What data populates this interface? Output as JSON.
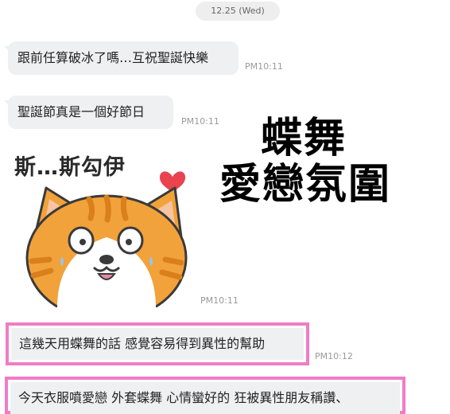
{
  "date_separator": "12.25 (Wed)",
  "messages": [
    {
      "text": "跟前任算破冰了嗎…互祝聖誕快樂",
      "time": "PM10:11"
    },
    {
      "text": "聖誕節真是一個好節日",
      "time": "PM10:11"
    }
  ],
  "sticker": {
    "caption": "斯…斯勾伊",
    "heart_icon": "heart-icon",
    "character": "orange-white-cat-sticker",
    "time": "PM10:11"
  },
  "overlay_caption": {
    "line1": "蝶舞",
    "line2": "愛戀氛圍"
  },
  "highlighted_messages": [
    {
      "text": "這幾天用蝶舞的話 感覺容易得到異性的幫助",
      "time": "PM10:12"
    },
    {
      "text": "今天衣服噴愛戀 外套蝶舞 心情蠻好的 狂被異性朋友稱讚、",
      "time": ""
    }
  ],
  "colors": {
    "bubble": "#eff0f2",
    "highlight_border": "#f07cc6",
    "heart": "#e8434f",
    "cat_orange": "#f2a23a"
  }
}
